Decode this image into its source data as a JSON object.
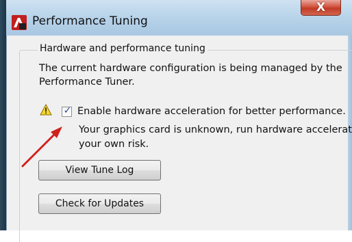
{
  "window": {
    "title": "Performance Tuning",
    "close_label": "X"
  },
  "group": {
    "title": "Hardware and performance tuning",
    "description": "The current hardware configuration is being managed by the Performance Tuner."
  },
  "hardware_acceleration": {
    "checked": true,
    "label": "Enable hardware acceleration for better performance.",
    "note_line1": "Your graphics card is unknown, run hardware accelerat",
    "note_line2": "your own risk."
  },
  "buttons": {
    "view_tune_log": "View Tune Log",
    "check_for_updates": "Check for Updates"
  },
  "icons": {
    "app": "autocad-app-icon",
    "warning": "warning-icon",
    "annotation": "red-arrow"
  },
  "colors": {
    "titlebar": "#b9d4ea",
    "close_button": "#c13a25",
    "checkmark": "#2a4f9a",
    "annotation_arrow": "#d0211c"
  }
}
